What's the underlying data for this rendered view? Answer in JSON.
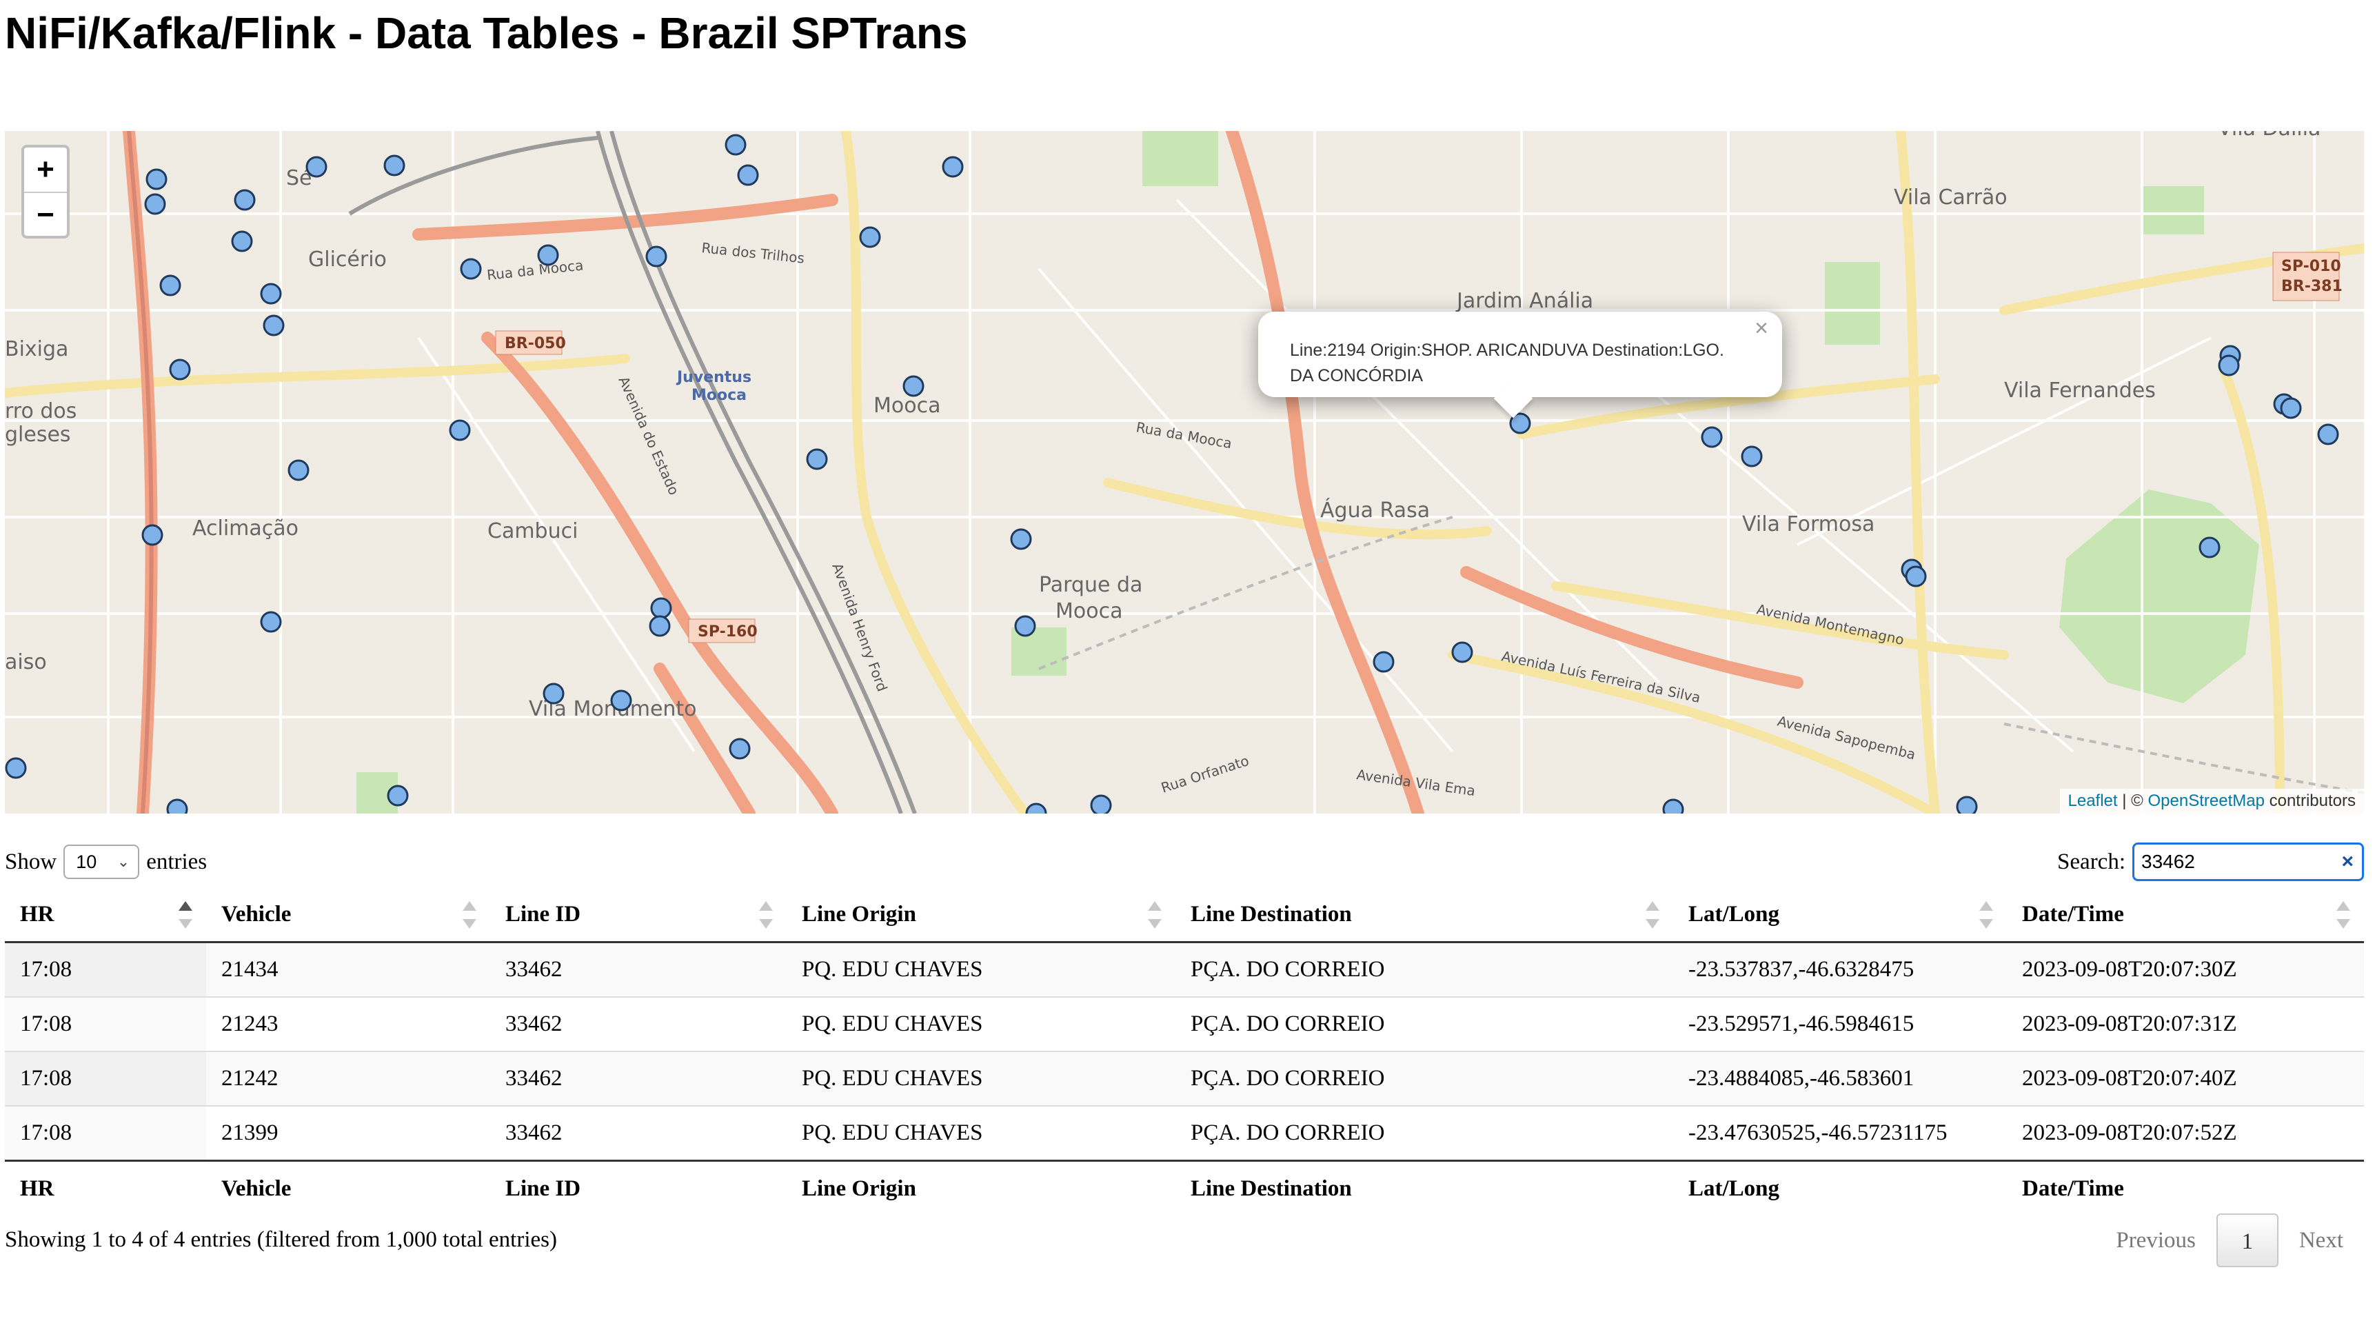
{
  "title": "NiFi/Kafka/Flink - Data Tables - Brazil SPTrans",
  "map": {
    "zoom_in": "+",
    "zoom_out": "−",
    "popup_text": "Line:2194 Origin:SHOP. ARICANDUVA Destination:LGO. DA CONCÓRDIA",
    "popup_close": "×",
    "attribution": {
      "leaflet": "Leaflet",
      "separator": " | © ",
      "osm": "OpenStreetMap",
      "suffix": " contributors"
    },
    "labels": {
      "se": "Sé",
      "glicerio": "Glicério",
      "bixiga": "Bixiga",
      "rro_dos": "rro dos",
      "gleses": "gleses",
      "aclimacao": "Aclimação",
      "cambuci": "Cambuci",
      "aiso": "aiso",
      "juventus": "Juventus",
      "mooca_station": "Mooca",
      "mooca": "Mooca",
      "parque_da": "Parque da",
      "parque_mooca": "Mooca",
      "vila_monumento": "Vila Monumento",
      "agua_rasa": "Água Rasa",
      "jardim_analia": "Jardim Anália",
      "vila_carrao": "Vila Carrão",
      "vila_fernandes": "Vila Fernandes",
      "vila_formosa": "Vila Formosa",
      "vila_dalila": "Vila Dalila",
      "br050": "BR-050",
      "sp160": "SP-160",
      "sp010": "SP-010",
      "br381": "BR-381",
      "rua_da_mooca": "Rua da Mooca",
      "rua_da_mooca_2": "Rua da Mooca",
      "rua_dos_trilhos": "Rua dos Trilhos",
      "av_do_estado": "Avenida do Estado",
      "av_henry_ford": "Avenida Henry Ford",
      "av_montemagno": "Avenida Montemagno",
      "av_luis_ferreira": "Avenida Luís Ferreira da Silva",
      "av_sapopemba": "Avenida Sapopemba",
      "av_vila_ema": "Avenida Vila Ema",
      "rua_orfanato": "Rua Orfanato"
    }
  },
  "length": {
    "show": "Show",
    "value": "10",
    "entries": "entries"
  },
  "search": {
    "label": "Search:",
    "value": "33462",
    "clear": "×"
  },
  "table": {
    "columns": [
      "HR",
      "Vehicle",
      "Line ID",
      "Line Origin",
      "Line Destination",
      "Lat/Long",
      "Date/Time"
    ],
    "rows": [
      [
        "17:08",
        "21434",
        "33462",
        "PQ. EDU CHAVES",
        "PÇA. DO CORREIO",
        "-23.537837,-46.6328475",
        "2023-09-08T20:07:30Z"
      ],
      [
        "17:08",
        "21243",
        "33462",
        "PQ. EDU CHAVES",
        "PÇA. DO CORREIO",
        "-23.529571,-46.5984615",
        "2023-09-08T20:07:31Z"
      ],
      [
        "17:08",
        "21242",
        "33462",
        "PQ. EDU CHAVES",
        "PÇA. DO CORREIO",
        "-23.4884085,-46.583601",
        "2023-09-08T20:07:40Z"
      ],
      [
        "17:08",
        "21399",
        "33462",
        "PQ. EDU CHAVES",
        "PÇA. DO CORREIO",
        "-23.47630525,-46.57231175",
        "2023-09-08T20:07:52Z"
      ]
    ]
  },
  "info": "Showing 1 to 4 of 4 entries (filtered from 1,000 total entries)",
  "pagination": {
    "previous": "Previous",
    "page": "1",
    "next": "Next"
  }
}
